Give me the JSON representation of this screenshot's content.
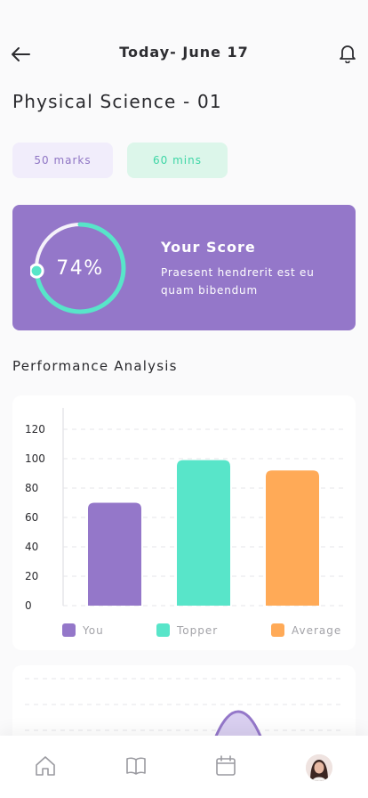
{
  "header": {
    "title": "Today- June 17",
    "back_icon": "arrow-left-icon",
    "bell_icon": "bell-icon"
  },
  "exam": {
    "title": "Physical Science - 01",
    "marks": "50 marks",
    "duration": "60 mins"
  },
  "score": {
    "percent_label": "74%",
    "percent_value": 74,
    "heading": "Your Score",
    "description": "Praesent hendrerit est eu quam bibendum"
  },
  "performance": {
    "title": "Performance Analysis"
  },
  "chart_data": {
    "type": "bar",
    "categories": [
      "You",
      "Topper",
      "Average"
    ],
    "values": [
      70,
      99,
      92
    ],
    "colors": [
      "#9477c9",
      "#58e5c9",
      "#ffaa57"
    ],
    "ylim": [
      0,
      120
    ],
    "yticks": [
      "0",
      "20",
      "40",
      "60",
      "80",
      "100",
      "120"
    ],
    "grid": true,
    "legend": "bottom"
  },
  "colors": {
    "accent_purple": "#9477c9",
    "accent_green": "#58e5c9",
    "accent_orange": "#ffaa57"
  },
  "tabbar": {
    "items": [
      "home-icon",
      "book-icon",
      "calendar-icon",
      "profile-avatar"
    ]
  }
}
